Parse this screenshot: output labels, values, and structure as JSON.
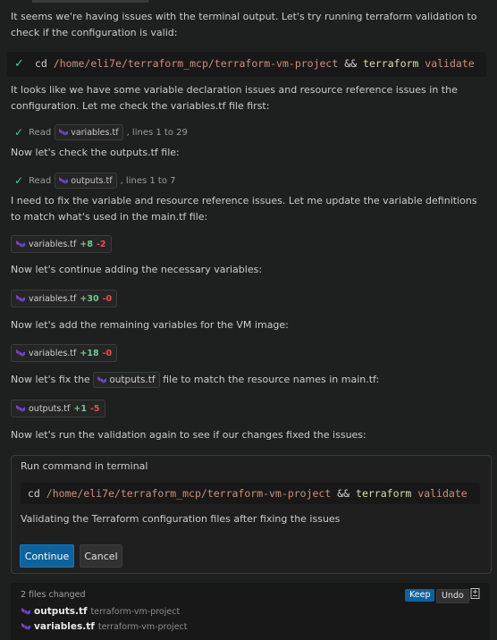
{
  "messages": {
    "intro": "It seems we're having issues with the terminal output. Let's try running terraform validation to check if the configuration is valid:",
    "after_cmd": "It looks like we have some variable declaration issues and resource reference issues in the configuration. Let me check the variables.tf file first:",
    "check_outputs": "Now let's check the outputs.tf file:",
    "need_fix": "I need to fix the variable and resource reference issues. Let me update the variable definitions to match what's used in the main.tf file:",
    "continue_adding": "Now let's continue adding the necessary variables:",
    "remaining_vars": "Now let's add the remaining variables for the VM image:",
    "fix_prefix": "Now let's fix the",
    "fix_file": "outputs.tf",
    "fix_suffix": "file to match the resource names in main.tf:",
    "run_again": "Now let's run the validation again to see if our changes fixed the issues:"
  },
  "command1": {
    "cd": "cd",
    "path": "/home/eli7e/terraform_mcp/terraform-vm-project",
    "and": "&&",
    "tool": "terraform",
    "arg": "validate"
  },
  "read1": {
    "label": "Read",
    "file": "variables.tf",
    "range": ", lines 1 to 29"
  },
  "read2": {
    "label": "Read",
    "file": "outputs.tf",
    "range": ", lines 1 to 7"
  },
  "edits": [
    {
      "file": "variables.tf",
      "added": "+8",
      "removed": "-2"
    },
    {
      "file": "variables.tf",
      "added": "+30",
      "removed": "-0"
    },
    {
      "file": "variables.tf",
      "added": "+18",
      "removed": "-0"
    },
    {
      "file": "outputs.tf",
      "added": "+1",
      "removed": "-5"
    }
  ],
  "terminal_panel": {
    "title": "Run command in terminal",
    "command": {
      "cd": "cd",
      "path": "/home/eli7e/terraform_mcp/terraform-vm-project",
      "and": "&&",
      "tool": "terraform",
      "arg": "validate"
    },
    "description": "Validating the Terraform configuration files after fixing the issues",
    "continue_label": "Continue",
    "cancel_label": "Cancel"
  },
  "changes": {
    "count_label": "2 files changed",
    "keep_label": "Keep",
    "undo_label": "Undo",
    "files": [
      {
        "name": "outputs.tf",
        "path": "terraform-vm-project"
      },
      {
        "name": "variables.tf",
        "path": "terraform-vm-project"
      }
    ]
  },
  "colors": {
    "terraform_icon": "#7b42bc",
    "check": "#4ec9b0",
    "added": "#73c991",
    "removed": "#f14c4c",
    "primary_button": "#0e639c"
  },
  "icons": [
    "check-icon",
    "terraform-icon",
    "diff-icon"
  ]
}
